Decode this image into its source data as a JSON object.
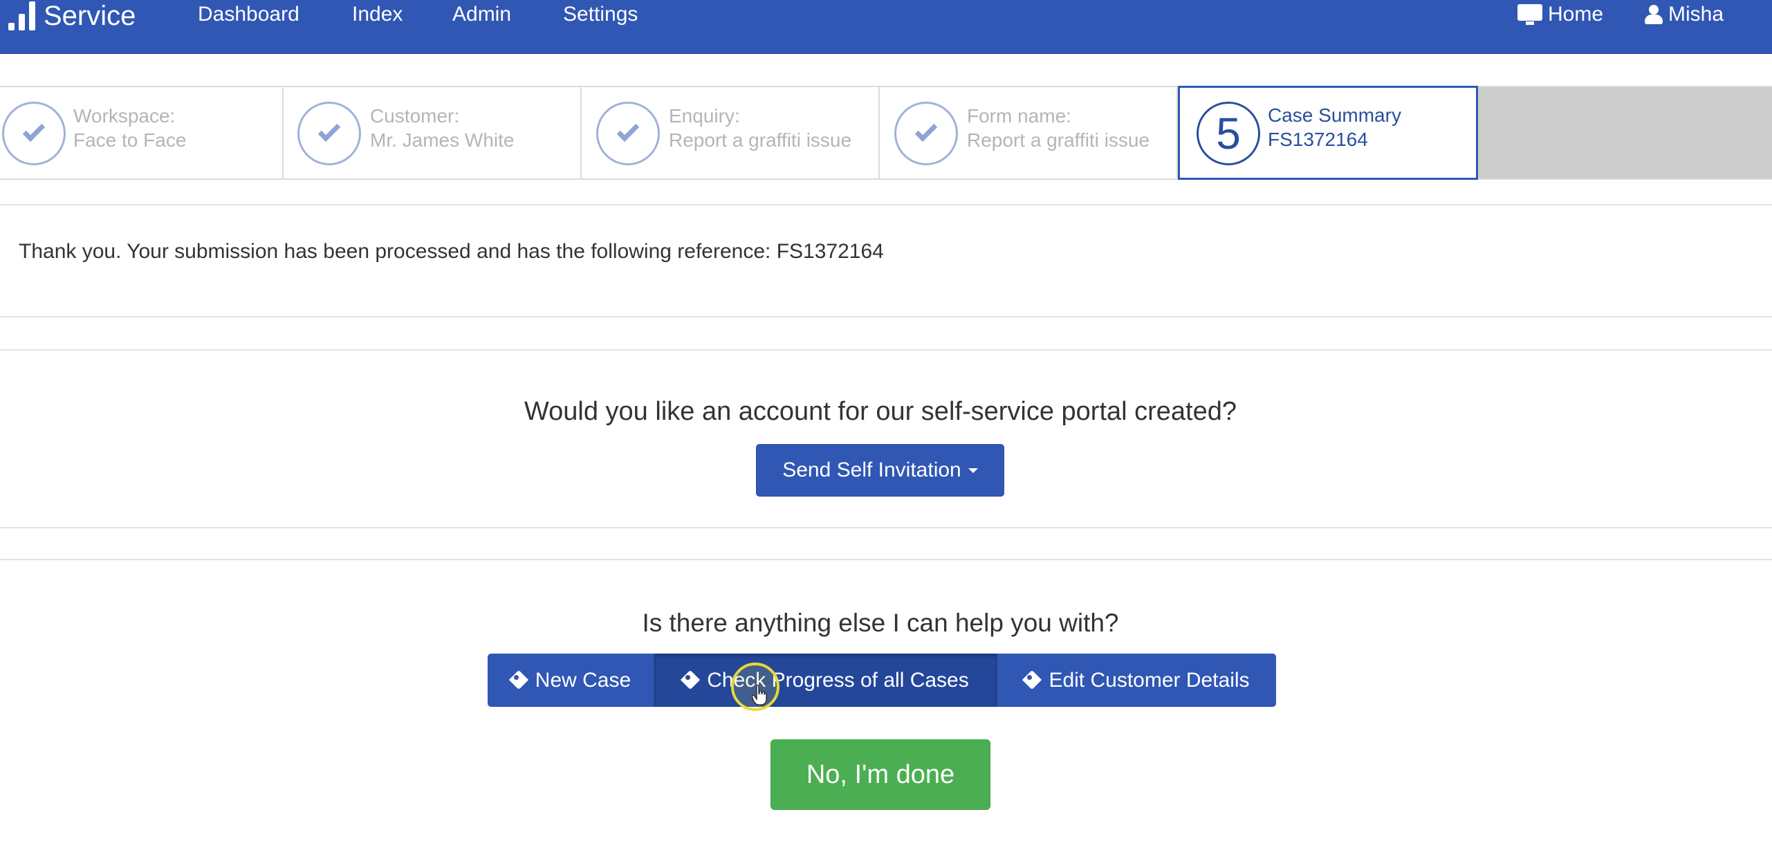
{
  "navbar": {
    "brand": "Service",
    "links": [
      "Dashboard",
      "Index",
      "Admin",
      "Settings"
    ],
    "home_label": "Home",
    "user_label": "Misha"
  },
  "wizard": {
    "steps": [
      {
        "label": "Workspace:",
        "value": "Face to Face"
      },
      {
        "label": "Customer:",
        "value": "Mr. James White"
      },
      {
        "label": "Enquiry:",
        "value": "Report a graffiti issue"
      },
      {
        "label": "Form name:",
        "value": "Report a graffiti issue"
      },
      {
        "number": "5",
        "label": "Case Summary",
        "value": "FS1372164"
      }
    ]
  },
  "confirmation": {
    "message": "Thank you. Your submission has been processed and has the following reference: FS1372164"
  },
  "portal": {
    "question": "Would you like an account for our self-service portal created?",
    "invite_button": "Send Self Invitation"
  },
  "help": {
    "question": "Is there anything else I can help you with?",
    "new_case": "New Case",
    "check_progress": "Check Progress of all Cases",
    "edit_customer": "Edit Customer Details",
    "done_button": "No, I'm done"
  },
  "colors": {
    "primary": "#3057b3",
    "success": "#4cae52",
    "step_inactive": "#b5b5b5"
  }
}
